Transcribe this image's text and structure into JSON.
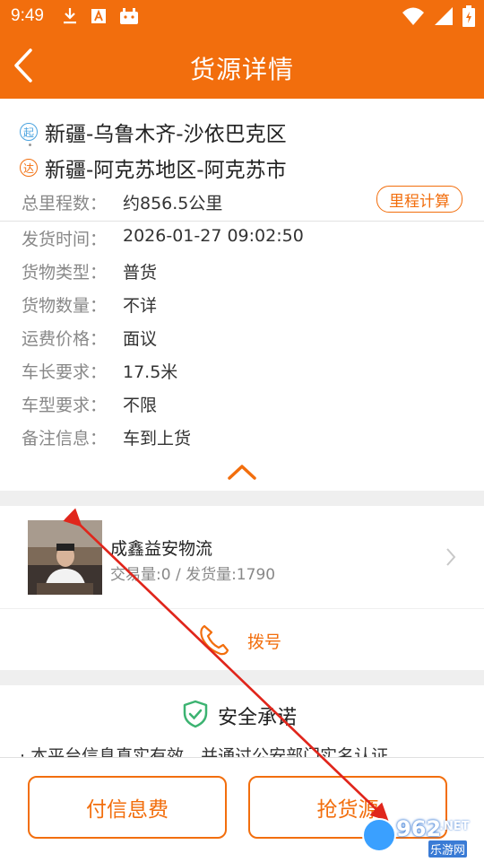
{
  "status_bar": {
    "time": "9:49",
    "left_icons": [
      "download-icon",
      "font-a-icon",
      "android-icon"
    ],
    "right_icons": [
      "wifi-icon",
      "signal-icon",
      "battery-icon"
    ]
  },
  "header": {
    "title": "货源详情"
  },
  "route": {
    "start_badge": "起",
    "start": "新疆-乌鲁木齐-沙依巴克区",
    "end_badge": "达",
    "end": "新疆-阿克苏地区-阿克苏市"
  },
  "mileage": {
    "label": "总里程数：",
    "value": "约856.5公里",
    "button": "里程计算"
  },
  "details": [
    {
      "label": "发货时间：",
      "value": "2026-01-27 09:02:50"
    },
    {
      "label": "货物类型：",
      "value": "普货"
    },
    {
      "label": "货物数量：",
      "value": "不详"
    },
    {
      "label": "运费价格：",
      "value": "面议"
    },
    {
      "label": "车长要求：",
      "value": "17.5米"
    },
    {
      "label": "车型要求：",
      "value": "不限"
    },
    {
      "label": "备注信息：",
      "value": "车到上货"
    }
  ],
  "shipper": {
    "name": "成鑫益安物流",
    "stats": "交易量:0 / 发货量:1790"
  },
  "call": {
    "label": "拨号"
  },
  "safety": {
    "title": "安全承诺",
    "text": "· 本平台信息真实有效，并通过公安部门实名认证"
  },
  "actions": {
    "pay_label": "付信息费",
    "grab_label": "抢货源"
  },
  "watermark": {
    "main": "962",
    "suffix": ".NET",
    "sub": "乐游网"
  },
  "colors": {
    "accent": "#f26e0d",
    "start_badge": "#4aa3df",
    "shield": "#3cb371",
    "annotation": "#e0261c"
  }
}
